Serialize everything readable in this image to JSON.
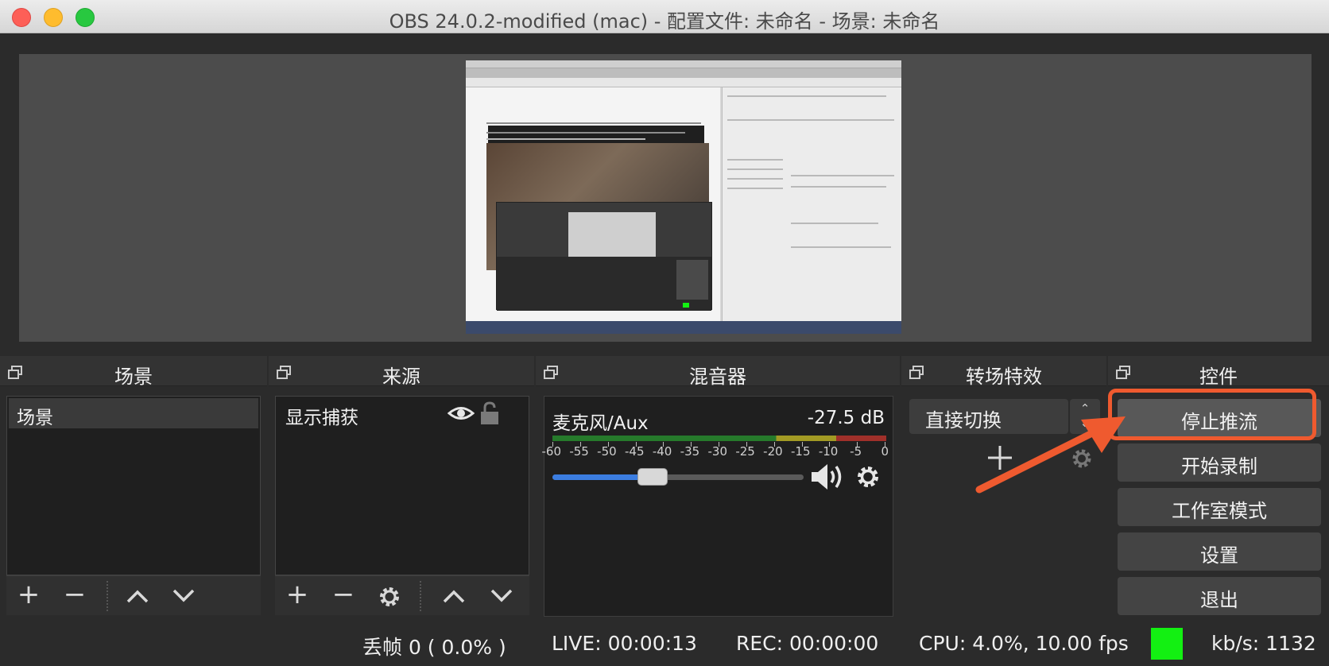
{
  "window": {
    "title": "OBS 24.0.2-modified (mac) - 配置文件: 未命名 - 场景: 未命名"
  },
  "docks": {
    "scenes": {
      "title": "场景",
      "items": [
        "场景"
      ]
    },
    "sources": {
      "title": "来源",
      "items": [
        "显示捕获"
      ]
    },
    "mixer": {
      "title": "混音器",
      "channel": "麦克风/Aux",
      "level_db": "-27.5 dB",
      "ticks": [
        "-60",
        "-55",
        "-50",
        "-45",
        "-40",
        "-35",
        "-30",
        "-25",
        "-20",
        "-15",
        "-10",
        "-5",
        "0"
      ],
      "volume_fraction": 0.4
    },
    "transitions": {
      "title": "转场特效",
      "selected": "直接切换"
    },
    "controls": {
      "title": "控件",
      "buttons": [
        "停止推流",
        "开始录制",
        "工作室模式",
        "设置",
        "退出"
      ]
    }
  },
  "status": {
    "dropped": "丢帧 0 ( 0.0% )",
    "live": "LIVE: 00:00:13",
    "rec": "REC: 00:00:00",
    "cpu": "CPU: 4.0%, 10.00 fps",
    "kbs": "kb/s: 1132",
    "live_color": "#13f012"
  },
  "annotation": {
    "color": "#ef5a2f"
  }
}
